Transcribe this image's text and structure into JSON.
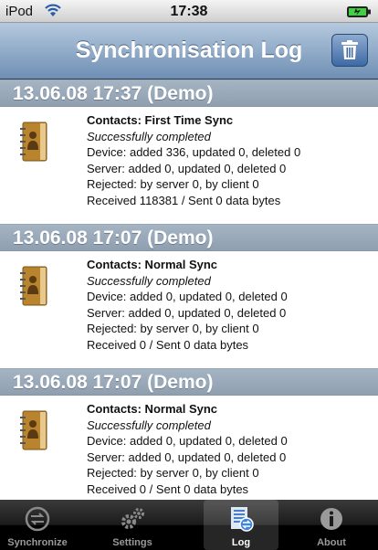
{
  "status_bar": {
    "carrier": "iPod",
    "time": "17:38"
  },
  "nav": {
    "title": "Synchronisation Log",
    "trash_icon": "trash-icon"
  },
  "log": [
    {
      "header": "13.06.08 17:37 (Demo)",
      "title": "Contacts: First Time Sync",
      "status": "Successfully completed",
      "device": "Device: added 336, updated 0, deleted 0",
      "server": "Server: added 0, updated 0, deleted 0",
      "rejected": "Rejected: by server 0, by client 0",
      "data": "Received 118381 / Sent 0 data bytes"
    },
    {
      "header": "13.06.08 17:07 (Demo)",
      "title": "Contacts: Normal Sync",
      "status": "Successfully completed",
      "device": "Device: added 0, updated 0, deleted 0",
      "server": "Server: added 0, updated 0, deleted 0",
      "rejected": "Rejected: by server 0, by client 0",
      "data": "Received 0 / Sent 0 data bytes"
    },
    {
      "header": "13.06.08 17:07 (Demo)",
      "title": "Contacts: Normal Sync",
      "status": "Successfully completed",
      "device": "Device: added 0, updated 0, deleted 0",
      "server": "Server: added 0, updated 0, deleted 0",
      "rejected": "Rejected: by server 0, by client 0",
      "data": "Received 0 / Sent 0 data bytes"
    }
  ],
  "tabs": [
    {
      "label": "Synchronize",
      "icon": "sync-icon"
    },
    {
      "label": "Settings",
      "icon": "gears-icon"
    },
    {
      "label": "Log",
      "icon": "log-icon",
      "active": true
    },
    {
      "label": "About",
      "icon": "info-icon"
    }
  ],
  "colors": {
    "nav": "#6f8fb4",
    "section_header": "#98a8b8",
    "tabbar": "#000000"
  }
}
